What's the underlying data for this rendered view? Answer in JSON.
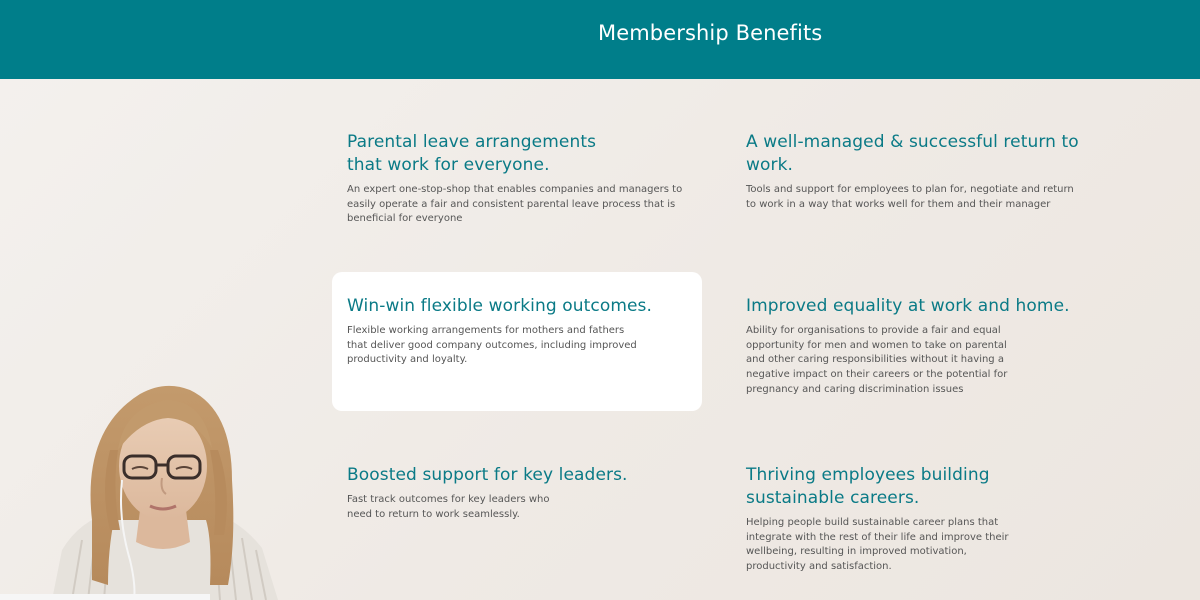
{
  "header": {
    "title": "Membership Benefits",
    "background_color": "#007e8a"
  },
  "benefits": [
    {
      "title": "Parental leave arrangements that work for everyone.",
      "description": "An expert one-stop-shop that enables companies and managers to easily operate a fair and consistent parental leave process that is beneficial for everyone"
    },
    {
      "title": "A well-managed & successful return to work.",
      "description": "Tools and support for employees to plan for, negotiate and return to work in a way that works well for them and their manager"
    },
    {
      "title": "Win-win flexible working outcomes.",
      "description": "Flexible working arrangements for mothers and fathers that deliver good company outcomes, including improved productivity and loyalty.",
      "highlighted": true
    },
    {
      "title": "Improved equality at work and home.",
      "description": "Ability for organisations to provide a fair and equal opportunity for men and women to take on parental and other caring responsibilities without it having a negative impact on their careers or the potential for pregnancy and caring discrimination issues"
    },
    {
      "title": "Boosted support for key leaders.",
      "description": "Fast track outcomes for key leaders who need to return to work seamlessly."
    },
    {
      "title": "Thriving employees building sustainable careers.",
      "description": "Helping people build sustainable career plans that integrate with the rest of their life and improve their wellbeing, resulting in improved motivation, productivity and satisfaction."
    }
  ],
  "colors": {
    "accent": "#0a7a86",
    "body_text": "#565656",
    "card_background": "#ffffff"
  },
  "photo": {
    "icon": "woman-with-laptop-photo"
  }
}
